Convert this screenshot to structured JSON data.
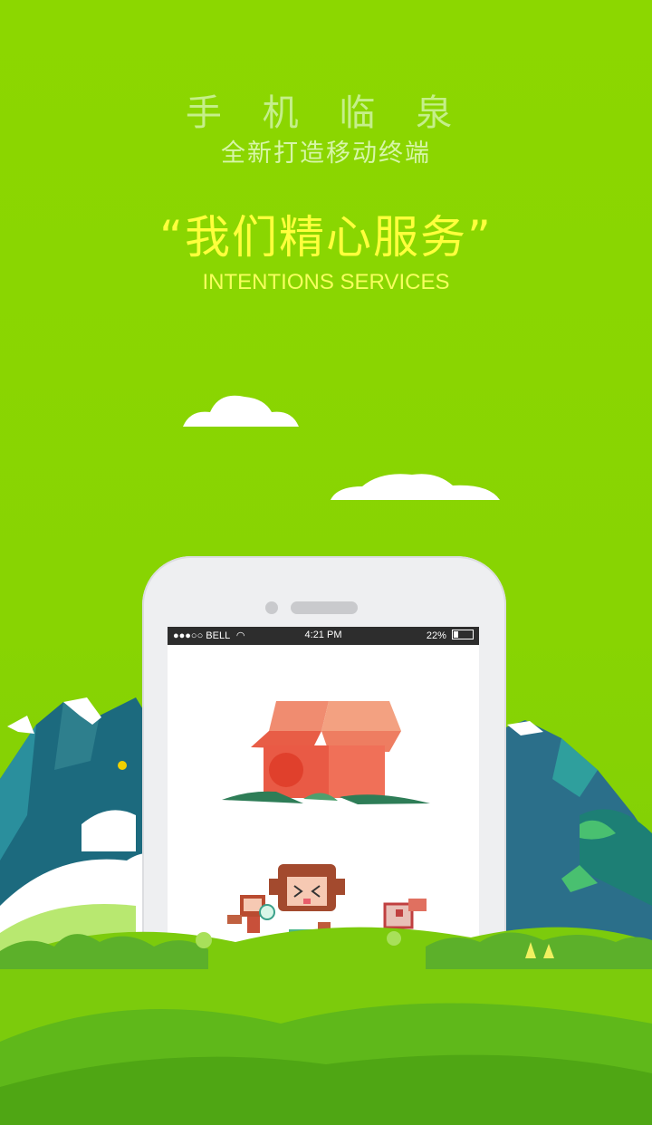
{
  "header": {
    "title": "手 机 临 泉",
    "subtitle": "全新打造移动终端",
    "slogan": "“我们精心服务”",
    "slogan_en": "INTENTIONS SERVICES"
  },
  "phone_status": {
    "carrier": "●●●○○ BELL",
    "time": "4:21 PM",
    "battery": "22%"
  },
  "colors": {
    "background": "#8ad600",
    "slogan": "#ffff3c",
    "title": "#c5ef8a",
    "box": "#ee6a50"
  }
}
